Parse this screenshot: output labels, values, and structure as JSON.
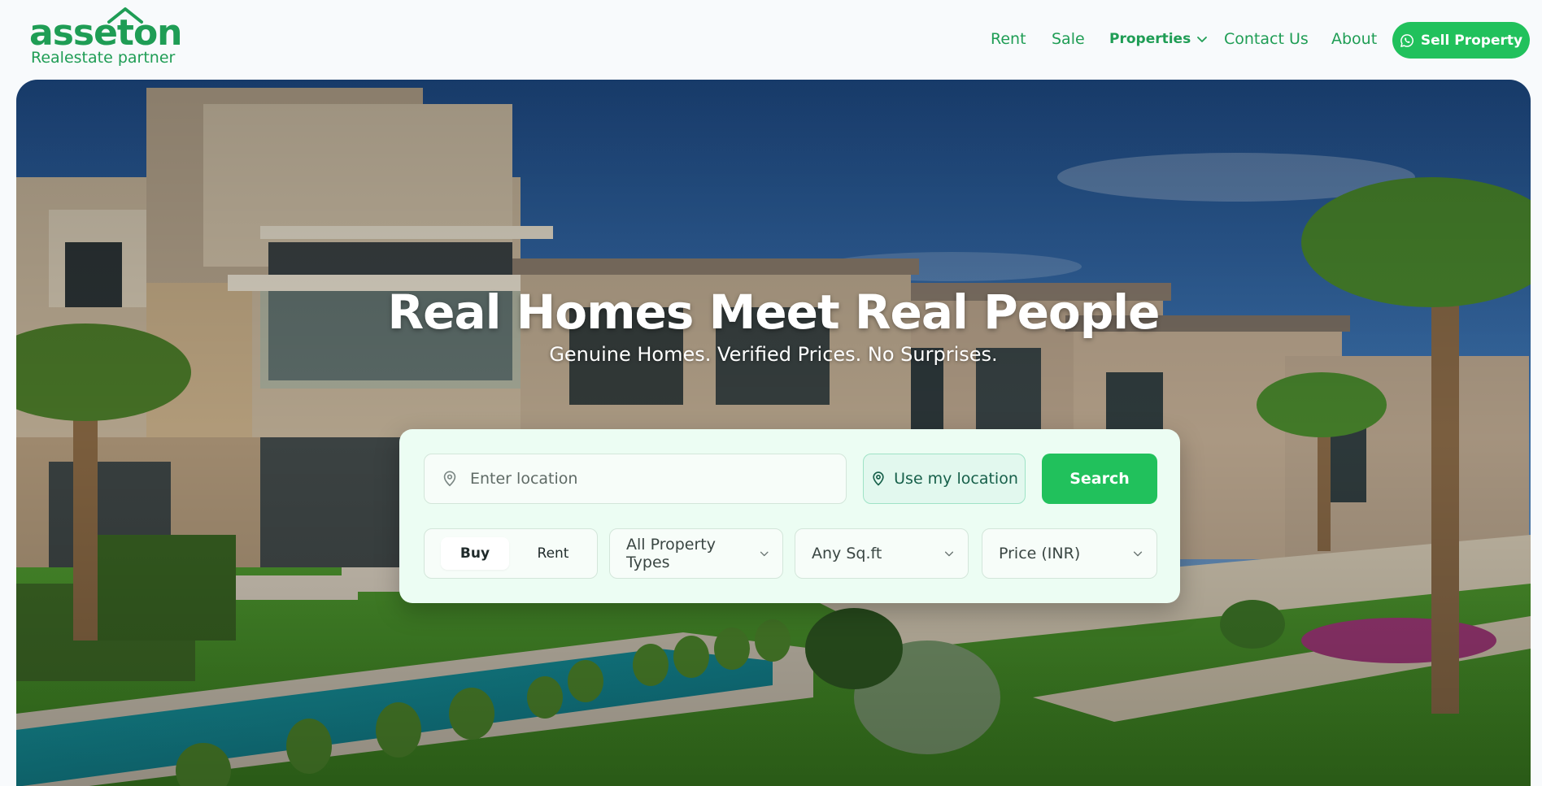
{
  "brand": {
    "name": "asseton",
    "tagline": "Realestate partner",
    "color": "#1f9d55"
  },
  "nav": {
    "rent": "Rent",
    "sale": "Sale",
    "properties": "Properties",
    "contact": "Contact Us",
    "about": "About",
    "sell_button": "Sell Property",
    "sell_icon": "whatsapp-icon"
  },
  "hero": {
    "title": "Real Homes Meet Real People",
    "subtitle": "Genuine Homes. Verified Prices. No Surprises."
  },
  "search": {
    "location_placeholder": "Enter location",
    "use_location": "Use my location",
    "search_button": "Search",
    "mode_buy": "Buy",
    "mode_rent": "Rent",
    "active_mode": "Buy",
    "property_type": "All Property Types",
    "sqft": "Any Sq.ft",
    "price": "Price (INR)"
  },
  "colors": {
    "accent": "#21c15c",
    "panel_bg": "#ecfdf3"
  }
}
